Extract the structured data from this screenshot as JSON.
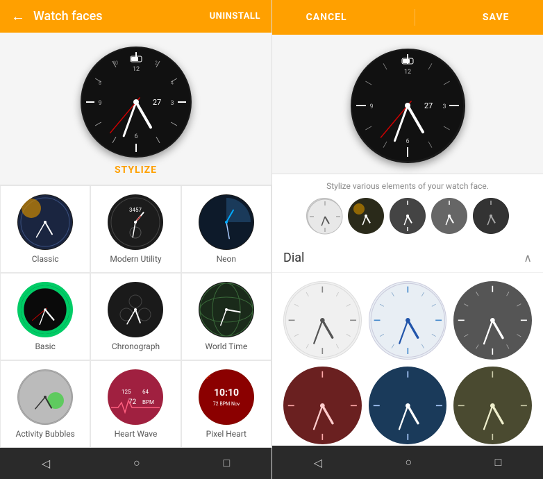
{
  "left": {
    "header": {
      "title": "Watch faces",
      "uninstall_label": "UNINSTALL",
      "back_icon": "←"
    },
    "stylize_label": "STYLIZE",
    "watch_items": [
      {
        "id": "classic",
        "label": "Classic",
        "face_class": "face-classic"
      },
      {
        "id": "modern_utility",
        "label": "Modern Utility",
        "face_class": "face-modern"
      },
      {
        "id": "neon",
        "label": "Neon",
        "face_class": "face-neon"
      },
      {
        "id": "basic",
        "label": "Basic",
        "face_class": "face-basic-ring"
      },
      {
        "id": "chronograph",
        "label": "Chronograph",
        "face_class": "face-chrono"
      },
      {
        "id": "world_time",
        "label": "World Time",
        "face_class": "face-world"
      },
      {
        "id": "activity_bubbles",
        "label": "Activity Bubbles",
        "face_class": "face-activity-style"
      },
      {
        "id": "heart_wave",
        "label": "Heart Wave",
        "face_class": "face-heart-style"
      },
      {
        "id": "pixel_heart",
        "label": "Pixel Heart",
        "face_class": "face-pixel-style"
      }
    ],
    "nav": {
      "back_icon": "◁",
      "home_icon": "○",
      "recents_icon": "□"
    }
  },
  "right": {
    "header": {
      "cancel_label": "CANCEL",
      "save_label": "SAVE"
    },
    "stylize_hint": "Stylize various elements of your watch face.",
    "style_options": [
      {
        "id": "opt1",
        "class": "style-opt-1"
      },
      {
        "id": "opt2",
        "class": "style-opt-2"
      },
      {
        "id": "opt3",
        "class": "style-opt-3"
      },
      {
        "id": "opt4",
        "class": "style-opt-4"
      },
      {
        "id": "opt5",
        "class": "style-opt-5"
      }
    ],
    "dial": {
      "title": "Dial",
      "chevron": "^",
      "options": [
        {
          "id": "white",
          "class": "dial-opt-white"
        },
        {
          "id": "blue",
          "class": "dial-opt-blue"
        },
        {
          "id": "dark",
          "class": "dial-opt-dark"
        },
        {
          "id": "darkred",
          "class": "dial-opt-darkred"
        },
        {
          "id": "navy",
          "class": "dial-opt-navy"
        },
        {
          "id": "olive",
          "class": "dial-opt-olive"
        }
      ]
    },
    "nav": {
      "back_icon": "◁",
      "home_icon": "○",
      "recents_icon": "□"
    }
  }
}
